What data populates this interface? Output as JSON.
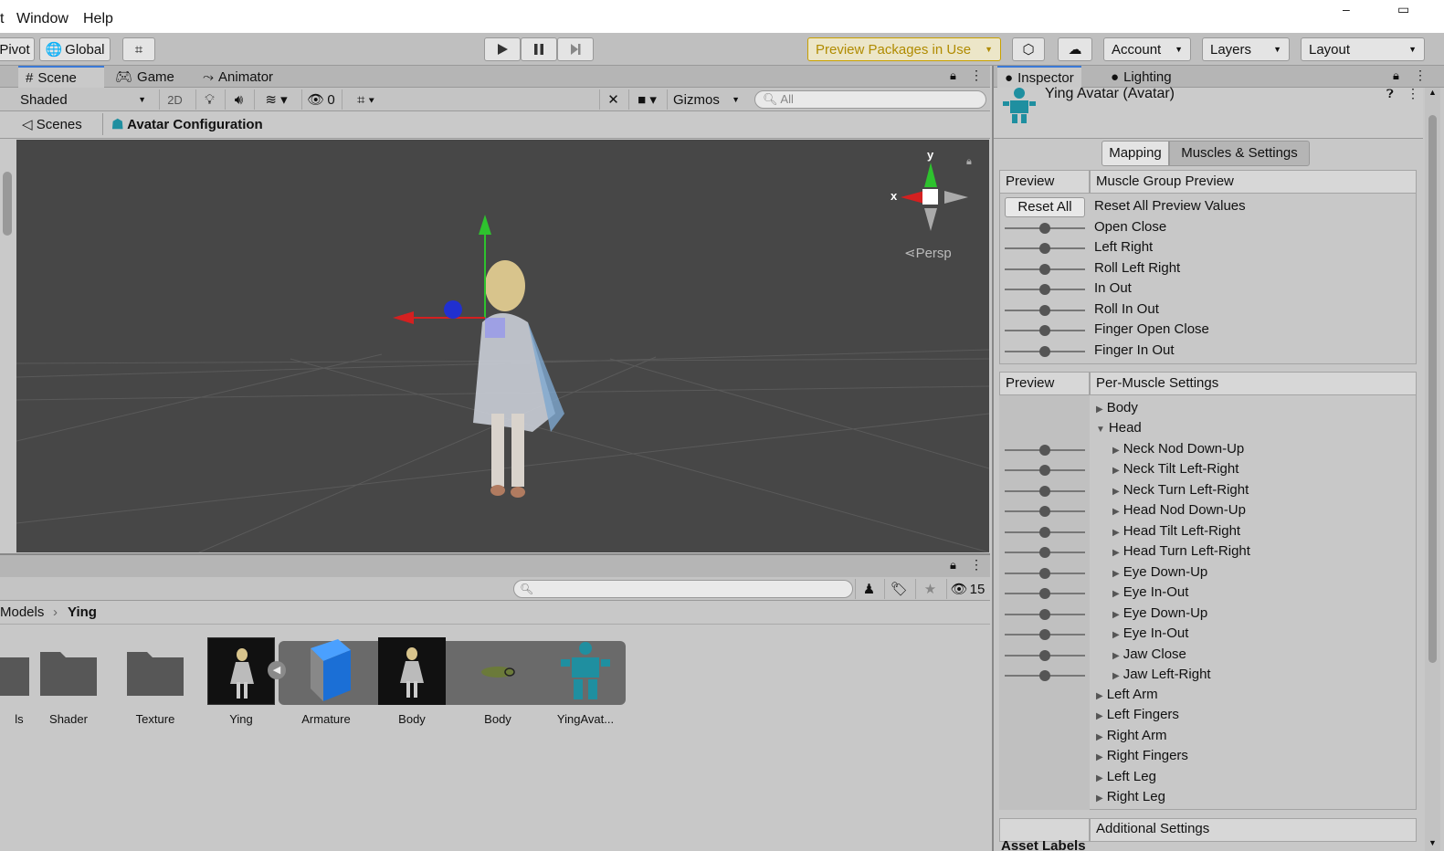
{
  "menu": {
    "left_fragment": "t",
    "window": "Window",
    "help": "Help"
  },
  "toolbar": {
    "pivot": "Pivot",
    "global": "Global",
    "preview_packages": "Preview Packages in Use",
    "account": "Account",
    "layers": "Layers",
    "layout": "Layout"
  },
  "scene_panel": {
    "tabs": [
      "Scene",
      "Game",
      "Animator"
    ],
    "shading": "Shaded",
    "mode_2d": "2D",
    "hidden_count": "0",
    "gizmos": "Gizmos",
    "search_placeholder": "All",
    "breadcrumb_scenes": "Scenes",
    "breadcrumb_config": "Avatar Configuration",
    "persp": "Persp",
    "axis_x": "x",
    "axis_y": "y"
  },
  "project_panel": {
    "breadcrumb_parent": "Models",
    "breadcrumb_current": "Ying",
    "hidden_count": "15",
    "assets": [
      {
        "label": "ls"
      },
      {
        "label": "Shader"
      },
      {
        "label": "Texture"
      },
      {
        "label": "Ying"
      },
      {
        "label": "Armature"
      },
      {
        "label": "Body"
      },
      {
        "label": "Body"
      },
      {
        "label": "YingAvat..."
      }
    ]
  },
  "inspector": {
    "tabs": [
      "Inspector",
      "Lighting"
    ],
    "title": "Ying Avatar (Avatar)",
    "subtabs": [
      "Mapping",
      "Muscles & Settings"
    ],
    "group_preview": {
      "col1": "Preview",
      "col2": "Muscle Group Preview",
      "reset_button": "Reset All",
      "reset_label": "Reset All Preview Values",
      "rows": [
        "Open Close",
        "Left Right",
        "Roll Left Right",
        "In Out",
        "Roll In Out",
        "Finger Open Close",
        "Finger In Out"
      ]
    },
    "per_muscle": {
      "col1": "Preview",
      "col2": "Per-Muscle Settings",
      "body": "Body",
      "head": "Head",
      "head_items": [
        "Neck Nod Down-Up",
        "Neck Tilt Left-Right",
        "Neck Turn Left-Right",
        "Head Nod Down-Up",
        "Head Tilt Left-Right",
        "Head Turn Left-Right",
        "Eye Down-Up",
        "Eye In-Out",
        "Eye Down-Up",
        "Eye In-Out",
        "Jaw Close",
        "Jaw Left-Right"
      ],
      "groups": [
        "Left Arm",
        "Left Fingers",
        "Right Arm",
        "Right Fingers",
        "Left Leg",
        "Right Leg"
      ]
    },
    "additional": "Additional Settings",
    "asset_labels": "Asset Labels"
  },
  "colors": {
    "accent": "#3a79d6",
    "preview_packages": "#c8a000",
    "avatar_icon": "#1f8fa0"
  }
}
